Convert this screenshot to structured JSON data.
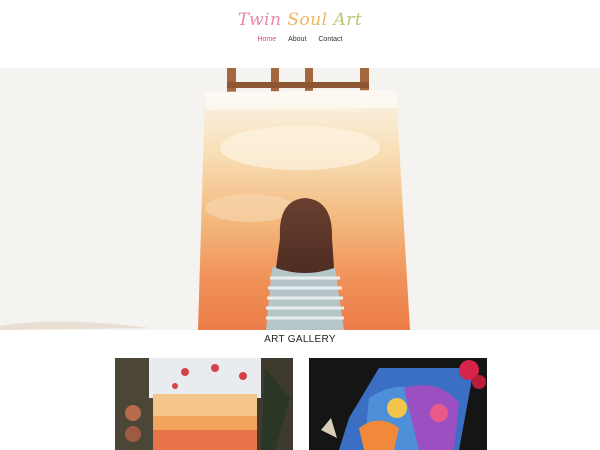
{
  "site": {
    "logo_word1": "Twin",
    "logo_word2": "Soul",
    "logo_word3": "Art"
  },
  "nav": {
    "items": [
      "Home",
      "About",
      "Contact"
    ],
    "active": "Home"
  },
  "gallery": {
    "title": "ART GALLERY"
  },
  "colors": {
    "active_nav": "#e0418a",
    "logo_pink": "#e68aa6",
    "logo_orange": "#f0b35a",
    "logo_green": "#b7c96e"
  }
}
